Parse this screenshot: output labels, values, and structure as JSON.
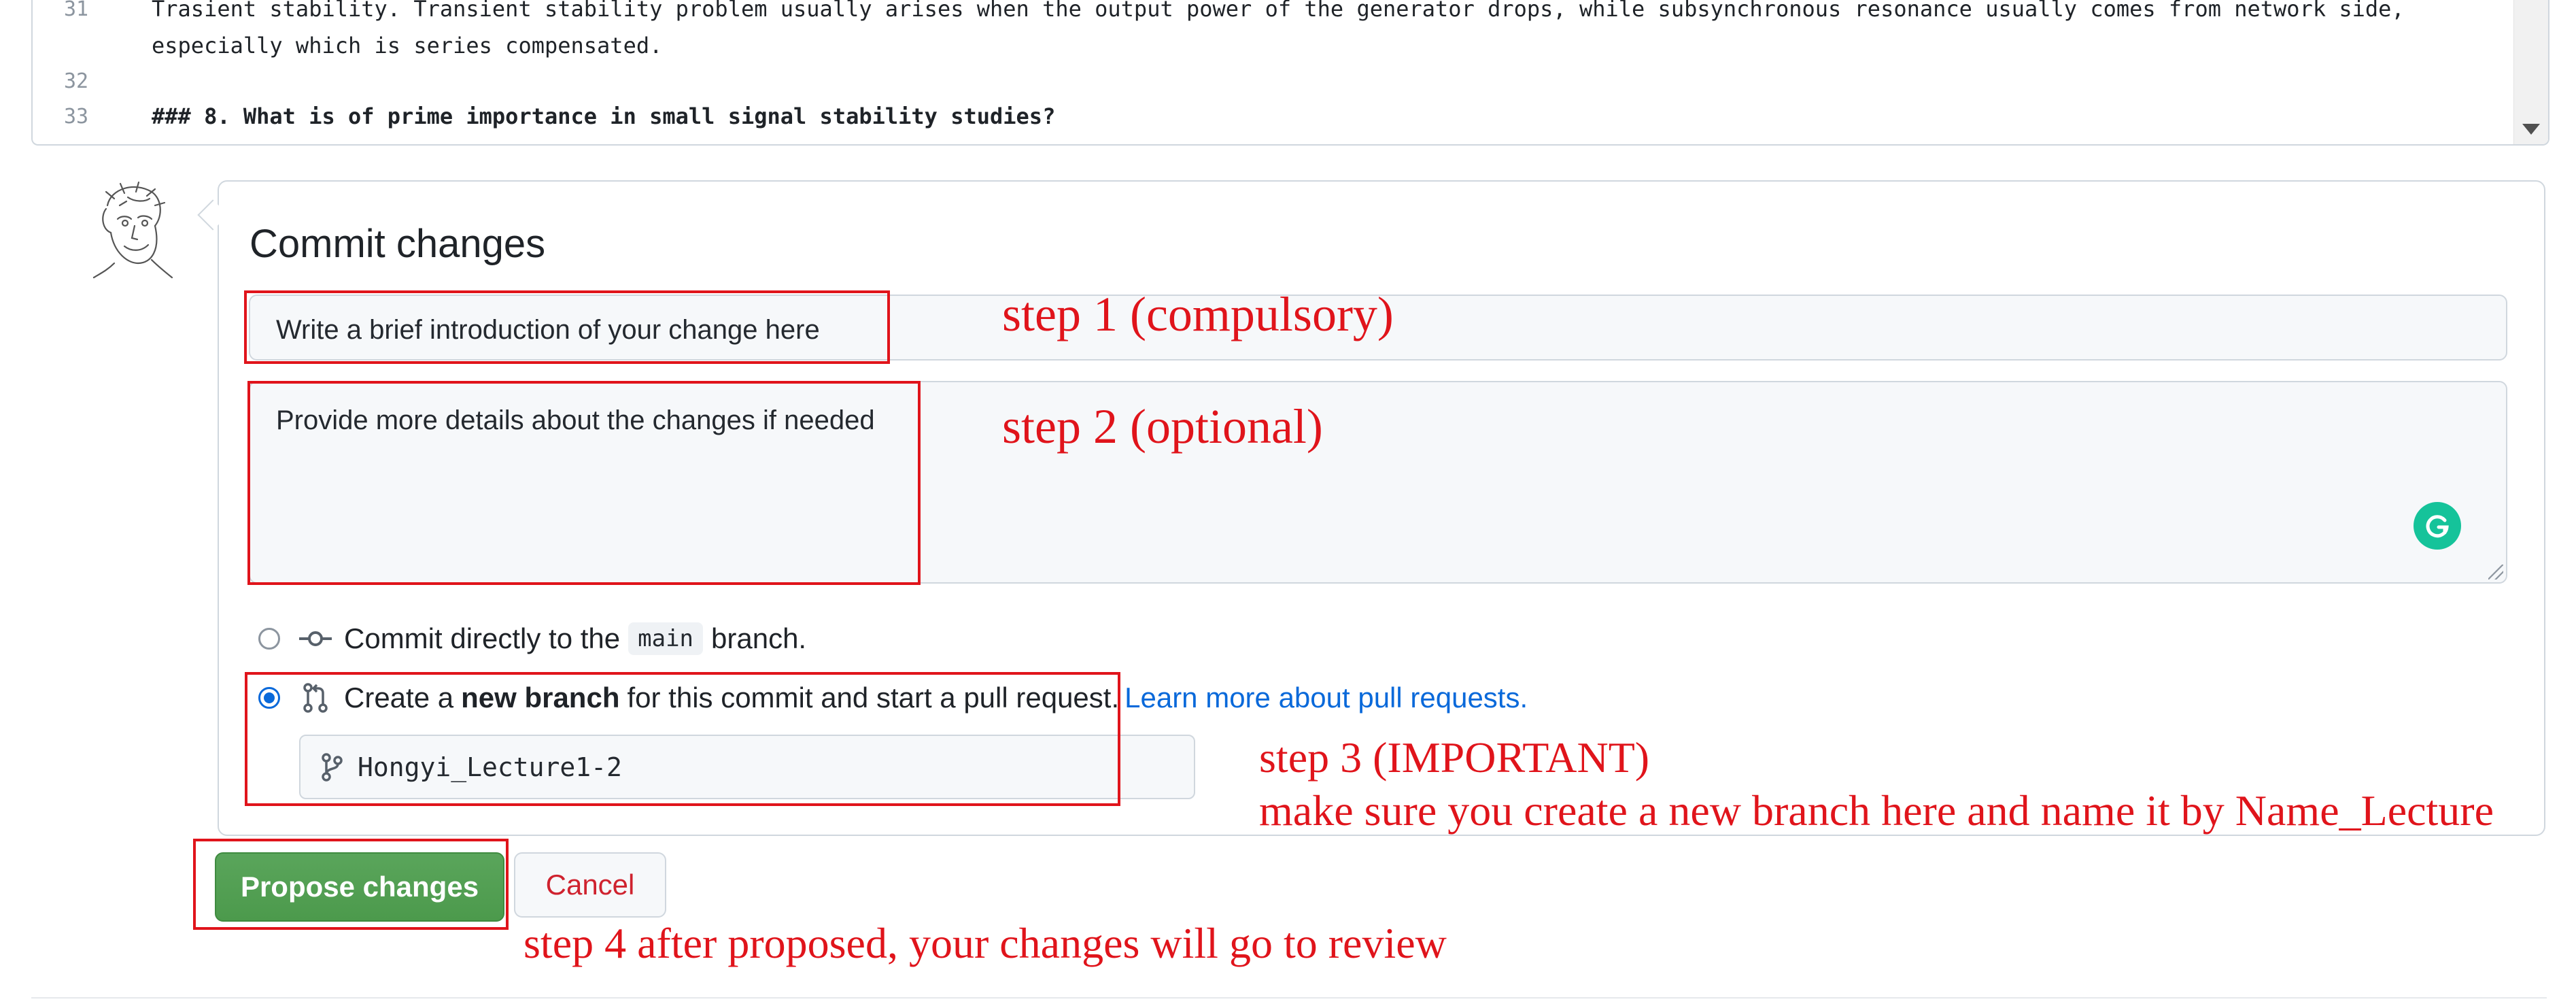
{
  "editor": {
    "lines": [
      {
        "num": "31",
        "text": "Trasient stability. Transient stability problem usually arises when the output power of the generator drops, while subsynchronous resonance usually comes from network side,",
        "bold": false
      },
      {
        "num": "",
        "text": "especially which is series compensated.",
        "bold": false
      },
      {
        "num": "32",
        "text": "",
        "bold": false
      },
      {
        "num": "33",
        "text": "### 8. What is of prime importance in small signal stability studies?",
        "bold": true
      }
    ]
  },
  "commit": {
    "title": "Commit changes",
    "summary_placeholder": "Write a brief introduction of your change here",
    "description_placeholder": "Provide more details about the changes if needed",
    "option_direct": {
      "prefix": "Commit directly to the",
      "branch": "main",
      "suffix": "branch.",
      "selected": false
    },
    "option_new": {
      "prefix": "Create a",
      "bold": "new branch",
      "suffix": "for this commit and start a pull request.",
      "link": "Learn more about pull requests.",
      "selected": true
    },
    "branch_name": "Hongyi_Lecture1-2",
    "propose_label": "Propose changes",
    "cancel_label": "Cancel"
  },
  "annotations": {
    "step1": "step 1 (compulsory)",
    "step2": "step 2 (optional)",
    "step3_title": "step 3 (IMPORTANT)",
    "step3_detail": "make sure you create a new branch here and name it by Name_Lecture",
    "step4": "step 4 after proposed, your changes will go to review"
  },
  "colors": {
    "annotation": "#e0141b",
    "propose": "#4c9a4c",
    "link": "#0969da",
    "cancel": "#cf222e"
  },
  "icons": {
    "direct": "git-commit-icon",
    "new": "git-pull-request-icon",
    "branch": "git-branch-icon",
    "grammarly": "grammarly-icon"
  }
}
